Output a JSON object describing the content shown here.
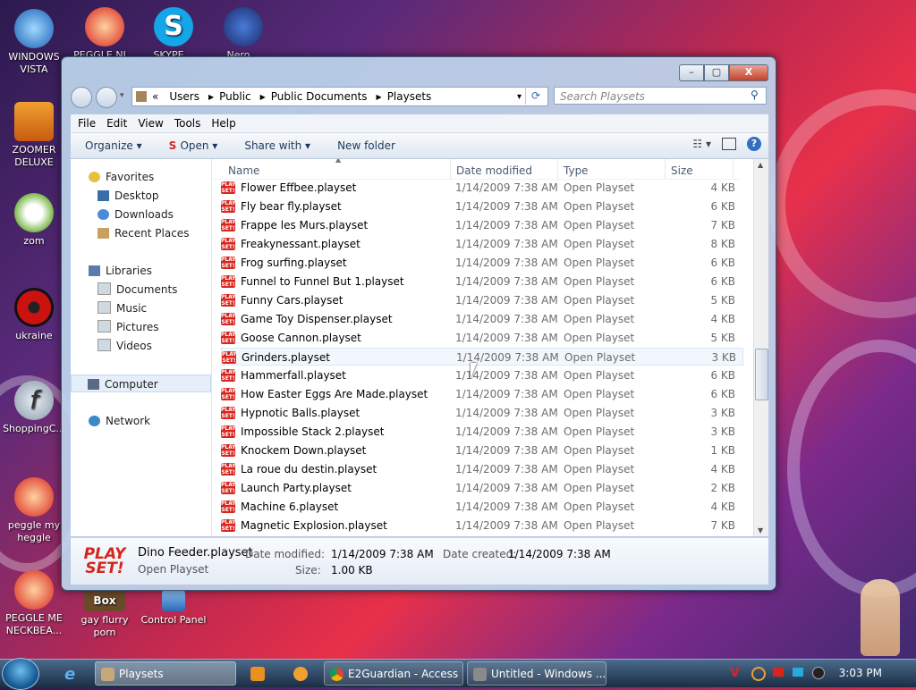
{
  "desktop": {
    "icons": [
      {
        "label": "WINDOWS VISTA",
        "color": "#2a7fd4"
      },
      {
        "label": "PEGGLE NI…",
        "color": "#e8452a"
      },
      {
        "label": "SKYPE…",
        "color": "#14a6e8"
      },
      {
        "label": "Nero…",
        "color": "#d9322a"
      },
      {
        "label": "ZOOMER DELUXE",
        "color": "#e87a1a"
      },
      {
        "label": "zom",
        "color": "#7db84a"
      },
      {
        "label": "ukraine",
        "color": "#cc1111"
      },
      {
        "label": "ShoppingC...",
        "color": "#9aa8b8"
      },
      {
        "label": "peggle my heggle",
        "color": "#e8452a"
      },
      {
        "label": "PEGGLE ME NECKBEA...",
        "color": "#e8452a"
      },
      {
        "label": "gay flurry porn",
        "color": "#6b4a2a"
      },
      {
        "label": "Control Panel",
        "color": "#3a7ac8"
      }
    ]
  },
  "window": {
    "minimize": "–",
    "maximize": "▢",
    "close": "X",
    "breadcrumb": [
      "«",
      "Users",
      "Public",
      "Public Documents",
      "Playsets"
    ],
    "search_placeholder": "Search Playsets",
    "menu": [
      "File",
      "Edit",
      "View",
      "Tools",
      "Help"
    ],
    "toolbar": {
      "organize": "Organize ▾",
      "open": "Open ▾",
      "share": "Share with ▾",
      "new_folder": "New folder"
    },
    "nav": {
      "favorites": "Favorites",
      "desktop": "Desktop",
      "downloads": "Downloads",
      "recent": "Recent Places",
      "libraries": "Libraries",
      "documents": "Documents",
      "music": "Music",
      "pictures": "Pictures",
      "videos": "Videos",
      "computer": "Computer",
      "network": "Network"
    },
    "columns": {
      "name": "Name",
      "date": "Date modified",
      "type": "Type",
      "size": "Size"
    },
    "files": [
      {
        "name": "Flower Effbee.playset",
        "date": "1/14/2009 7:38 AM",
        "type": "Open Playset",
        "size": "4 KB"
      },
      {
        "name": "Fly bear fly.playset",
        "date": "1/14/2009 7:38 AM",
        "type": "Open Playset",
        "size": "6 KB"
      },
      {
        "name": "Frappe les Murs.playset",
        "date": "1/14/2009 7:38 AM",
        "type": "Open Playset",
        "size": "7 KB"
      },
      {
        "name": "Freakynessant.playset",
        "date": "1/14/2009 7:38 AM",
        "type": "Open Playset",
        "size": "8 KB"
      },
      {
        "name": "Frog surfing.playset",
        "date": "1/14/2009 7:38 AM",
        "type": "Open Playset",
        "size": "6 KB"
      },
      {
        "name": "Funnel to Funnel But 1.playset",
        "date": "1/14/2009 7:38 AM",
        "type": "Open Playset",
        "size": "6 KB"
      },
      {
        "name": "Funny Cars.playset",
        "date": "1/14/2009 7:38 AM",
        "type": "Open Playset",
        "size": "5 KB"
      },
      {
        "name": "Game Toy Dispenser.playset",
        "date": "1/14/2009 7:38 AM",
        "type": "Open Playset",
        "size": "4 KB"
      },
      {
        "name": "Goose Cannon.playset",
        "date": "1/14/2009 7:38 AM",
        "type": "Open Playset",
        "size": "5 KB"
      },
      {
        "name": "Grinders.playset",
        "date": "1/14/2009 7:38 AM",
        "type": "Open Playset",
        "size": "3 KB"
      },
      {
        "name": "Hammerfall.playset",
        "date": "1/14/2009 7:38 AM",
        "type": "Open Playset",
        "size": "6 KB"
      },
      {
        "name": "How Easter Eggs Are Made.playset",
        "date": "1/14/2009 7:38 AM",
        "type": "Open Playset",
        "size": "6 KB"
      },
      {
        "name": "Hypnotic Balls.playset",
        "date": "1/14/2009 7:38 AM",
        "type": "Open Playset",
        "size": "3 KB"
      },
      {
        "name": "Impossible Stack 2.playset",
        "date": "1/14/2009 7:38 AM",
        "type": "Open Playset",
        "size": "3 KB"
      },
      {
        "name": "Knockem Down.playset",
        "date": "1/14/2009 7:38 AM",
        "type": "Open Playset",
        "size": "1 KB"
      },
      {
        "name": "La roue du destin.playset",
        "date": "1/14/2009 7:38 AM",
        "type": "Open Playset",
        "size": "4 KB"
      },
      {
        "name": "Launch Party.playset",
        "date": "1/14/2009 7:38 AM",
        "type": "Open Playset",
        "size": "2 KB"
      },
      {
        "name": "Machine 6.playset",
        "date": "1/14/2009 7:38 AM",
        "type": "Open Playset",
        "size": "4 KB"
      },
      {
        "name": "Magnetic Explosion.playset",
        "date": "1/14/2009 7:38 AM",
        "type": "Open Playset",
        "size": "7 KB"
      }
    ],
    "file_icon_text": "PLAY SET!",
    "details": {
      "icon_text": "PLAY SET!",
      "filename": "Dino Feeder.playset",
      "type": "Open Playset",
      "modified_label": "Date modified:",
      "modified": "1/14/2009 7:38 AM",
      "created_label": "Date created:",
      "created": "1/14/2009 7:38 AM",
      "size_label": "Size:",
      "size": "1.00 KB"
    }
  },
  "taskbar": {
    "buttons": [
      {
        "label": "Playsets",
        "active": true
      },
      {
        "label": "E2Guardian - Access ...",
        "active": false
      },
      {
        "label": "Untitled - Windows ...",
        "active": false
      }
    ],
    "clock": "3:03 PM"
  }
}
